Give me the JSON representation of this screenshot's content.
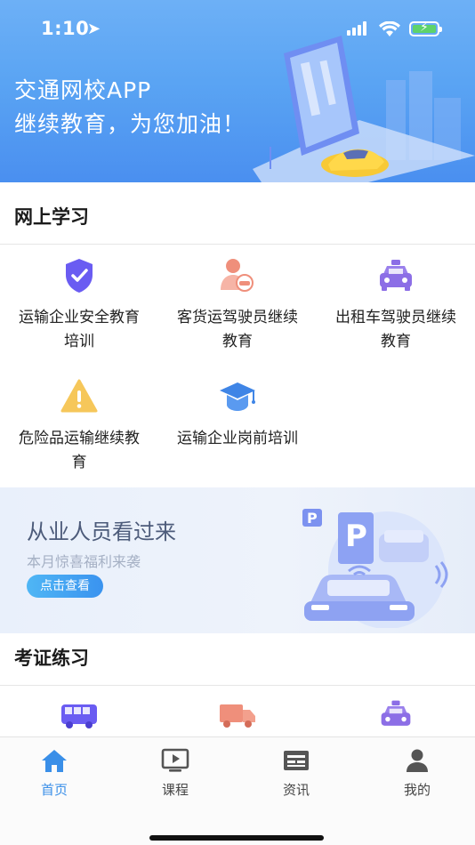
{
  "status_bar": {
    "time": "1:10"
  },
  "hero": {
    "title": "交通网校APP",
    "subtitle": "继续教育，为您加油！"
  },
  "online_study": {
    "title": "网上学习",
    "items": [
      {
        "label": "运输企业安全教育培训",
        "icon": "shield-check-icon"
      },
      {
        "label": "客货运驾驶员继续教育",
        "icon": "driver-icon"
      },
      {
        "label": "出租车驾驶员继续教育",
        "icon": "taxi-icon"
      },
      {
        "label": "危险品运输继续教育",
        "icon": "warning-icon"
      },
      {
        "label": "运输企业岗前培训",
        "icon": "graduation-cap-icon"
      }
    ]
  },
  "promo": {
    "title": "从业人员看过来",
    "subtitle": "本月惊喜福利来袭",
    "button": "点击查看"
  },
  "exam_practice": {
    "title": "考证练习",
    "items": [
      {
        "icon": "bus-icon"
      },
      {
        "icon": "truck-icon"
      },
      {
        "icon": "taxi-icon"
      }
    ]
  },
  "tabbar": {
    "tabs": [
      {
        "label": "首页",
        "icon": "home-icon",
        "active": true
      },
      {
        "label": "课程",
        "icon": "tv-icon",
        "active": false
      },
      {
        "label": "资讯",
        "icon": "news-icon",
        "active": false
      },
      {
        "label": "我的",
        "icon": "user-icon",
        "active": false
      }
    ]
  },
  "colors": {
    "accent": "#3a8fe8",
    "hero_bg": "#5aa4f3",
    "promo_button": "#3a93ef"
  }
}
